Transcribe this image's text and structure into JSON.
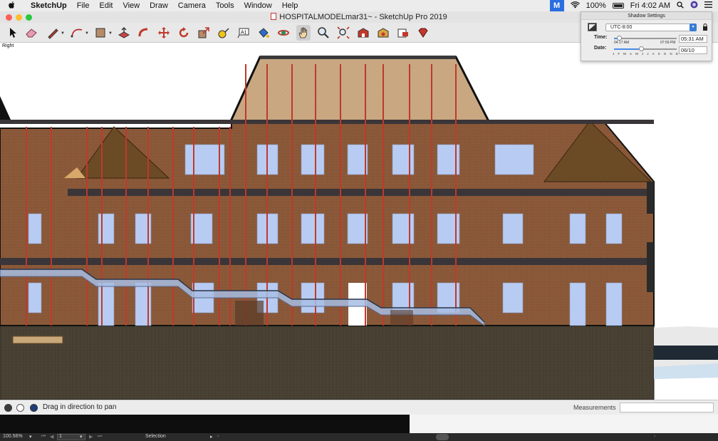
{
  "menubar": {
    "apple": "",
    "app_name": "SketchUp",
    "menus": [
      "File",
      "Edit",
      "View",
      "Draw",
      "Camera",
      "Tools",
      "Window",
      "Help"
    ],
    "status": {
      "badge": "M",
      "battery_percent": "100%",
      "clock": "Fri 4:02 AM"
    }
  },
  "window": {
    "title": "HOSPITALMODELmar31~ - SketchUp Pro 2019"
  },
  "toolbar": {
    "tools": [
      "select",
      "eraser",
      "line",
      "arc",
      "shape",
      "push-pull",
      "follow-me",
      "move",
      "rotate",
      "scale",
      "tape-measure",
      "text",
      "paint-bucket",
      "orbit",
      "pan",
      "zoom",
      "zoom-extents",
      "3d-warehouse",
      "extension-warehouse",
      "layout",
      "extension-manager"
    ],
    "active_tool": "pan"
  },
  "viewport": {
    "scene_label": "Right"
  },
  "shadow_settings": {
    "title": "Shadow Settings",
    "timezone": "UTC-8:00",
    "time_label": "Time:",
    "date_label": "Date:",
    "time_min": "04:17 AM",
    "time_max": "07:59 PM",
    "time_value": "05:31 AM",
    "date_value": "06/10",
    "time_slider_fraction": 0.08,
    "date_slider_fraction": 0.44,
    "months": [
      "J",
      "F",
      "M",
      "A",
      "M",
      "J",
      "J",
      "A",
      "S",
      "O",
      "N",
      "D"
    ]
  },
  "statusbar": {
    "message": "Drag in direction to pan",
    "measurements_label": "Measurements",
    "measurements_value": ""
  },
  "bottom_bar": {
    "zoom": "100.56%",
    "page": "1",
    "mode": "Selection"
  },
  "colors": {
    "brick": "#8c5a3a",
    "roof": "#6b4a26",
    "window": "#b8ccf3",
    "frame": "#c0392b",
    "ground": "#4a4335"
  }
}
